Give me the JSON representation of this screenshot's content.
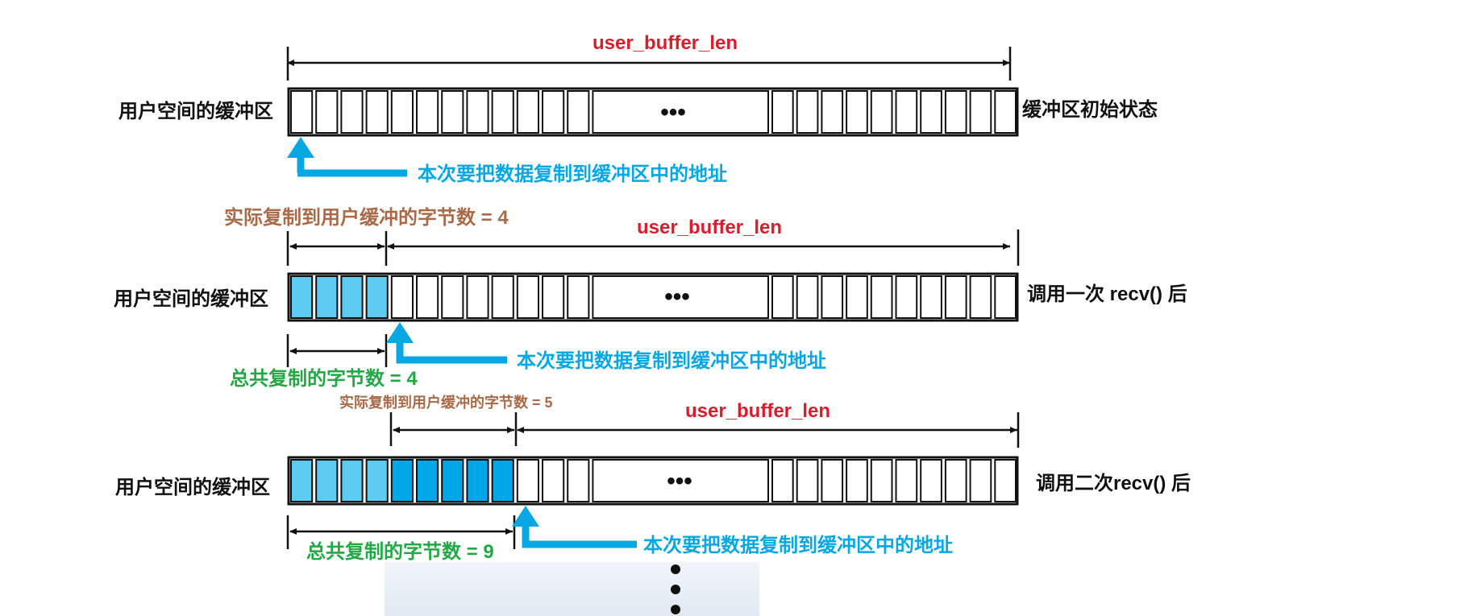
{
  "colors": {
    "red": "#d81e2a",
    "blue": "#06a7e2",
    "brown": "#a86a48",
    "green": "#22a845",
    "fill_light": "#5ccaf1",
    "fill_dark": "#00a7e8",
    "black": "#111111"
  },
  "ellipsis": "•••",
  "rows": [
    {
      "left_label": "用户空间的缓冲区",
      "right_label": "缓冲区初始状态",
      "top_label": "user_buffer_len",
      "pointer_label": "本次要把数据复制到缓冲区中的地址",
      "copied_label": "",
      "total_label": "",
      "light_cells": 0,
      "dark_cells": 0
    },
    {
      "left_label": "用户空间的缓冲区",
      "right_label": "调用一次 recv() 后",
      "top_label": "user_buffer_len",
      "pointer_label": "本次要把数据复制到缓冲区中的地址",
      "copied_label": "实际复制到用户缓冲的字节数 = 4",
      "total_label": "总共复制的字节数 = 4",
      "light_cells": 4,
      "dark_cells": 0
    },
    {
      "left_label": "用户空间的缓冲区",
      "right_label": "调用二次recv() 后",
      "top_label": "user_buffer_len",
      "pointer_label": "本次要把数据复制到缓冲区中的地址",
      "copied_label": "实际复制到用户缓冲的字节数 = 5",
      "total_label": "总共复制的字节数 = 9",
      "light_cells": 4,
      "dark_cells": 5
    }
  ],
  "continuation_icon": "vertical-ellipsis-icon"
}
